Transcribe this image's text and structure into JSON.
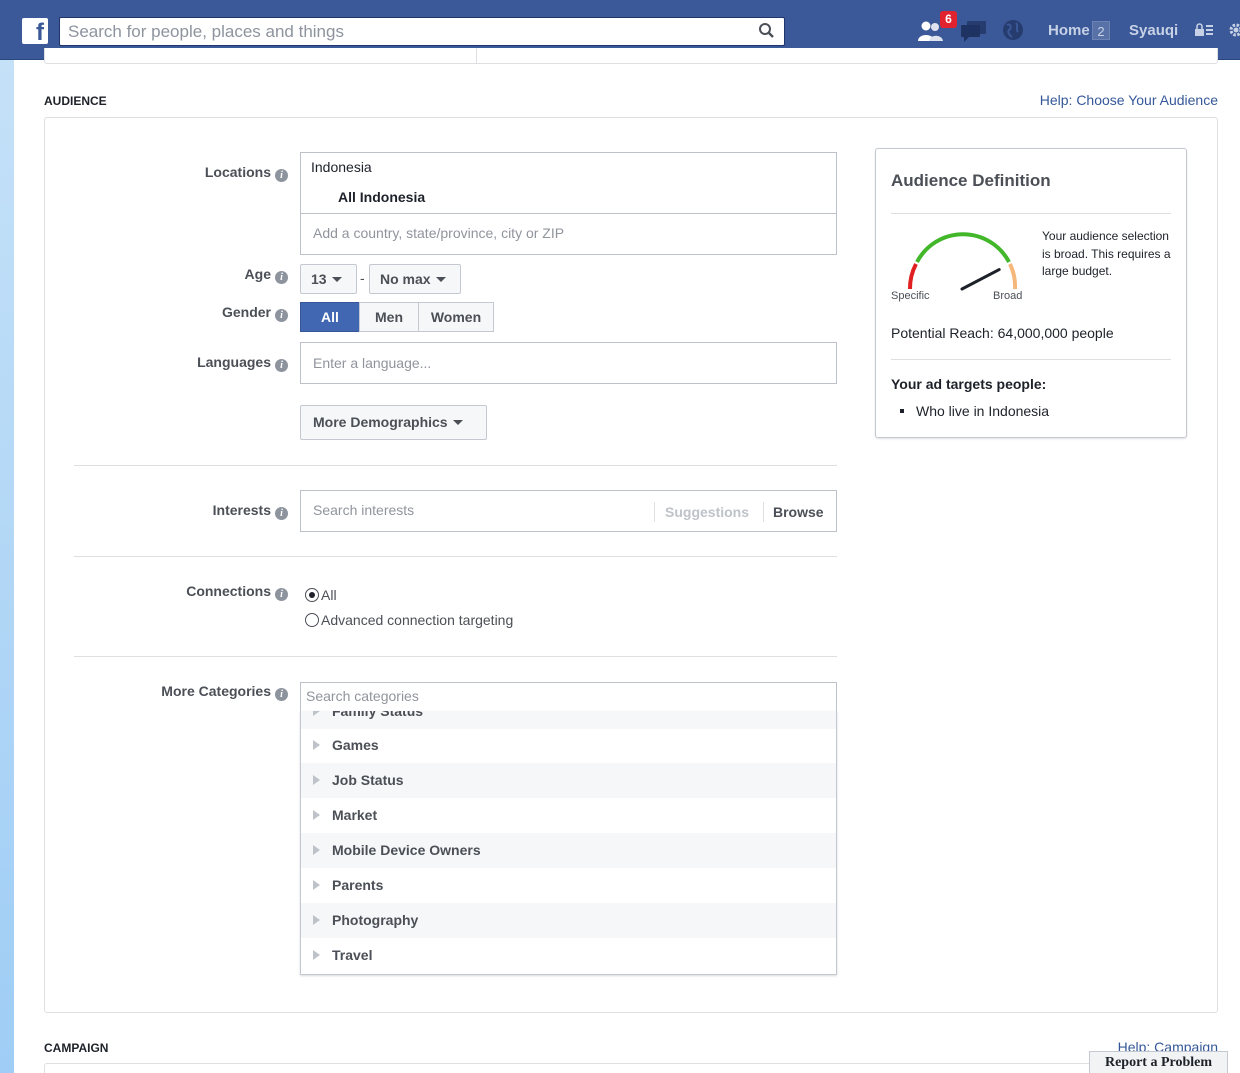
{
  "topbar": {
    "search_placeholder": "Search for people, places and things",
    "friend_requests_count": "6",
    "home_label": "Home",
    "home_count": "2",
    "user_name": "Syauqi"
  },
  "audience": {
    "section_title": "AUDIENCE",
    "help_link": "Help: Choose Your Audience",
    "locations": {
      "label": "Locations",
      "country": "Indonesia",
      "region": "All Indonesia",
      "placeholder": "Add a country, state/province, city or ZIP"
    },
    "age": {
      "label": "Age",
      "min": "13",
      "separator": "-",
      "max": "No max"
    },
    "gender": {
      "label": "Gender",
      "options": [
        "All",
        "Men",
        "Women"
      ],
      "selected": "All"
    },
    "languages": {
      "label": "Languages",
      "placeholder": "Enter a language..."
    },
    "more_demographics": "More Demographics",
    "interests": {
      "label": "Interests",
      "placeholder": "Search interests",
      "suggestions": "Suggestions",
      "browse": "Browse"
    },
    "connections": {
      "label": "Connections",
      "options": [
        "All",
        "Advanced connection targeting"
      ],
      "selected": "All"
    },
    "more_categories": {
      "label": "More Categories",
      "placeholder": "Search categories",
      "partial_item": "Family Status",
      "items": [
        "Games",
        "Job Status",
        "Market",
        "Mobile Device Owners",
        "Parents",
        "Photography",
        "Travel"
      ]
    }
  },
  "audience_definition": {
    "title": "Audience Definition",
    "note": "Your audience selection is broad. This requires a large budget.",
    "specific_label": "Specific",
    "broad_label": "Broad",
    "gauge_level": 0.92,
    "reach": "Potential Reach: 64,000,000 people",
    "targets_heading": "Your ad targets people:",
    "targets": [
      "Who live in Indonesia"
    ]
  },
  "campaign": {
    "section_title": "CAMPAIGN",
    "help_link": "Help: Campaign"
  },
  "report_problem": "Report a Problem",
  "colors": {
    "brand_blue": "#3b5998",
    "link_blue": "#365899",
    "selected_blue": "#4267b2",
    "badge_red": "#e0232e",
    "gauge_green": "#42b72a",
    "gauge_red": "#e02020",
    "gauge_orange": "#f5b87a"
  }
}
